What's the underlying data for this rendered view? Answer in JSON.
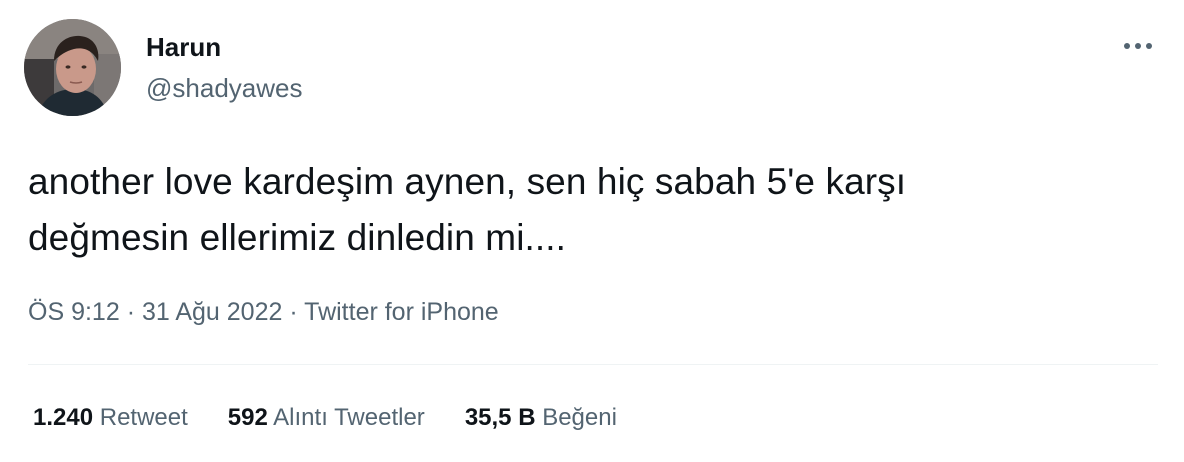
{
  "user": {
    "display_name": "Harun",
    "handle": "@shadyawes",
    "avatar_icon": "profile-photo"
  },
  "more_icon": "ellipsis-icon",
  "tweet": {
    "text": "another love kardeşim aynen, sen hiç sabah 5'e karşı\ndeğmesin ellerimiz dinledin mi...."
  },
  "meta": {
    "time": "ÖS 9:12",
    "separator": "·",
    "date": "31 Ağu 2022",
    "source": "Twitter for iPhone"
  },
  "stats": {
    "retweets": {
      "count": "1.240",
      "label": "Retweet"
    },
    "quotes": {
      "count": "592",
      "label": "Alıntı Tweetler"
    },
    "likes": {
      "count": "35,5 B",
      "label": "Beğeni"
    }
  },
  "colors": {
    "primary_text": "#0f1419",
    "secondary_text": "#536471",
    "divider": "#eff3f4",
    "background": "#ffffff"
  }
}
